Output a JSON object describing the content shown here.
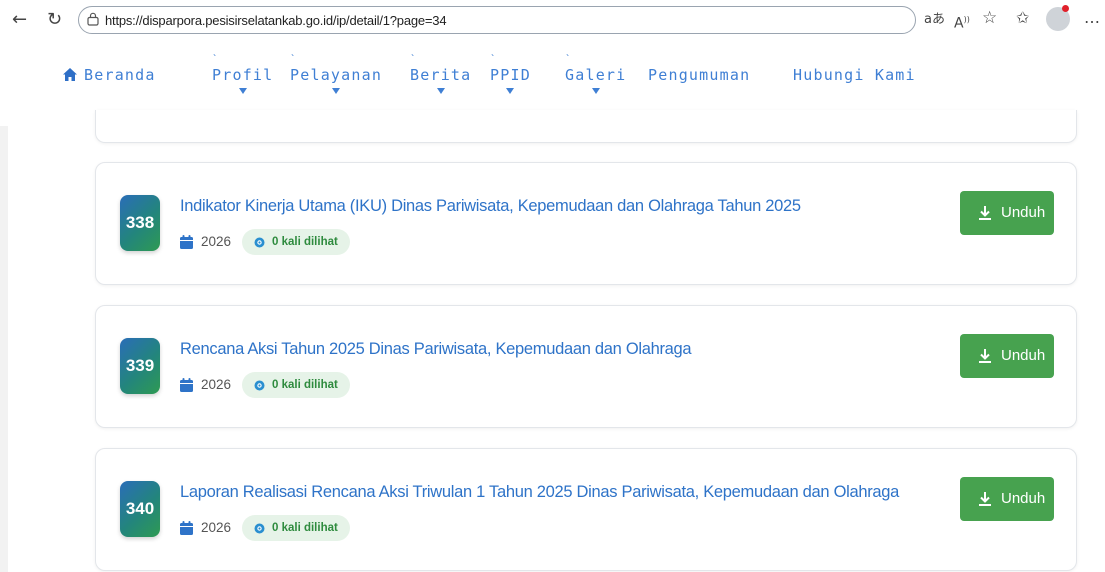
{
  "browser": {
    "url": "https://disparpora.pesisirselatankab.go.id/ip/detail/1?page=34"
  },
  "nav": {
    "items": [
      {
        "label": "Beranda",
        "icon": "home-icon",
        "has_dropdown": false
      },
      {
        "label": "Profil",
        "has_dropdown": true
      },
      {
        "label": "Pelayanan",
        "has_dropdown": true
      },
      {
        "label": "Berita",
        "has_dropdown": true
      },
      {
        "label": "PPID",
        "has_dropdown": true
      },
      {
        "label": "Galeri",
        "has_dropdown": true
      },
      {
        "label": "Pengumuman",
        "has_dropdown": false
      },
      {
        "label": "Hubungi Kami",
        "has_dropdown": false
      }
    ]
  },
  "documents": [
    {
      "number": "338",
      "title": "Indikator Kinerja Utama (IKU) Dinas Pariwisata, Kepemudaan dan Olahraga Tahun 2025",
      "year": "2026",
      "views": "0 kali dilihat",
      "download_label": "Unduh"
    },
    {
      "number": "339",
      "title": "Rencana Aksi Tahun 2025 Dinas Pariwisata, Kepemudaan dan Olahraga",
      "year": "2026",
      "views": "0 kali dilihat",
      "download_label": "Unduh"
    },
    {
      "number": "340",
      "title": "Laporan Realisasi Rencana Aksi Triwulan 1 Tahun 2025 Dinas Pariwisata, Kepemudaan dan Olahraga",
      "year": "2026",
      "views": "0 kali dilihat",
      "download_label": "Unduh"
    }
  ],
  "colors": {
    "link_blue": "#2e73c8",
    "nav_blue": "#3f7fd4",
    "button_green": "#47a24f",
    "views_green": "#2e8b3e",
    "views_bg": "#e6f3e8"
  }
}
